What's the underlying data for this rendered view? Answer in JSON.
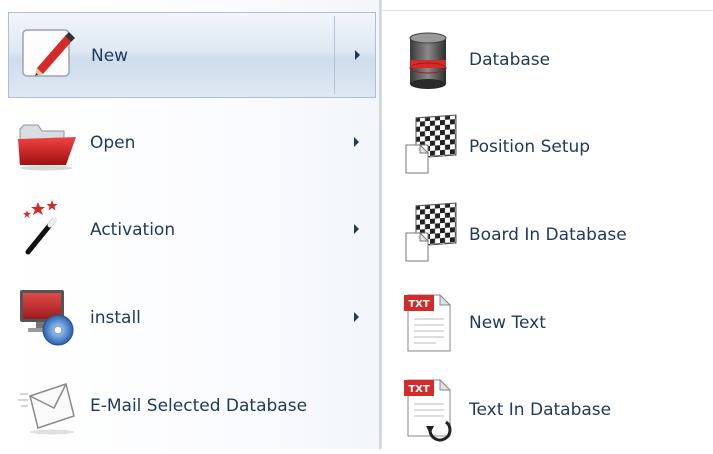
{
  "main_menu": {
    "items": [
      {
        "label": "New",
        "icon": "pencil-paper-icon",
        "has_submenu": true,
        "highlighted": true
      },
      {
        "label": "Open",
        "icon": "folder-icon",
        "has_submenu": true
      },
      {
        "label": "Activation",
        "icon": "magic-wand-icon",
        "has_submenu": true
      },
      {
        "label": "install",
        "icon": "monitor-disc-icon",
        "has_submenu": true
      },
      {
        "label": "E-Mail Selected Database",
        "icon": "envelope-icon",
        "has_submenu": false
      }
    ]
  },
  "submenu": {
    "items": [
      {
        "label": "Database",
        "icon": "database-icon"
      },
      {
        "label": "Position Setup",
        "icon": "chessboard-icon"
      },
      {
        "label": "Board In Database",
        "icon": "chessboard-icon"
      },
      {
        "label": "New Text",
        "icon": "txt-document-icon",
        "badge": "TXT"
      },
      {
        "label": "Text In Database",
        "icon": "txt-document-arrow-icon",
        "badge": "TXT"
      }
    ]
  },
  "colors": {
    "text": "#1e395b",
    "highlight_border": "#aebed3",
    "accent_red": "#d62a2a"
  }
}
